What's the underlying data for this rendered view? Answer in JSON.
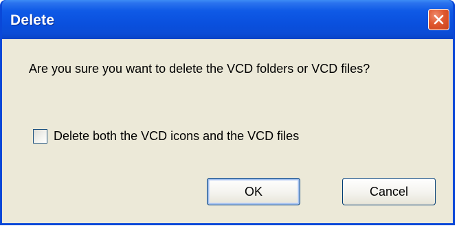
{
  "window": {
    "title": "Delete",
    "titlebar_color": "#0a50de",
    "close_button_color": "#e0582f"
  },
  "dialog": {
    "message": "Are you sure you want to delete the VCD folders or VCD files?",
    "checkbox": {
      "label": "Delete both the VCD icons and the VCD files",
      "checked": false
    },
    "buttons": {
      "ok_label": "OK",
      "cancel_label": "Cancel"
    },
    "background_color": "#ece9d8"
  },
  "icons": {
    "close": "close-icon"
  }
}
